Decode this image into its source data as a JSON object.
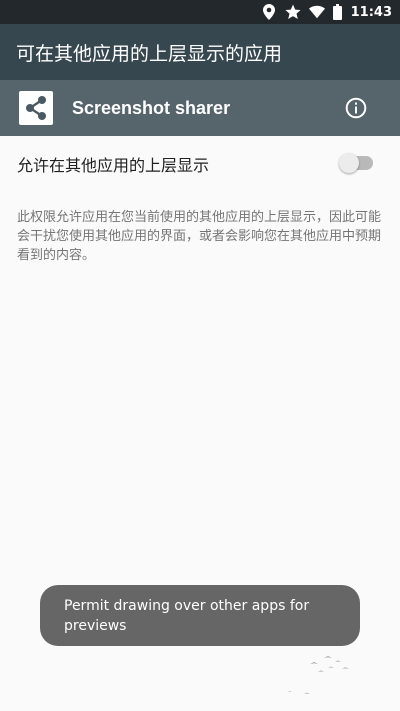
{
  "status_bar": {
    "time": "11:43",
    "icons": [
      "location-icon",
      "star-icon",
      "wifi-icon",
      "battery-icon"
    ]
  },
  "app_bar": {
    "title": "可在其他应用的上层显示的应用"
  },
  "app_header": {
    "app_name": "Screenshot sharer",
    "app_icon": "share-icon",
    "info_icon": "info-icon"
  },
  "setting": {
    "label": "允许在其他应用的上层显示",
    "enabled": false
  },
  "description": "此权限允许应用在您当前使用的其他应用的上层显示，因此可能会干扰您使用其他应用的界面，或者会影响您在其他应用中预期看到的内容。",
  "toast": {
    "message": "Permit drawing over other apps for previews"
  },
  "colors": {
    "status_bar": "#23282c",
    "app_bar": "#37474f",
    "app_header": "#56646b",
    "background": "#fafafa",
    "toast": "#666666",
    "toggle_off_track": "#b9b9b9",
    "toggle_off_thumb": "#ececec"
  }
}
